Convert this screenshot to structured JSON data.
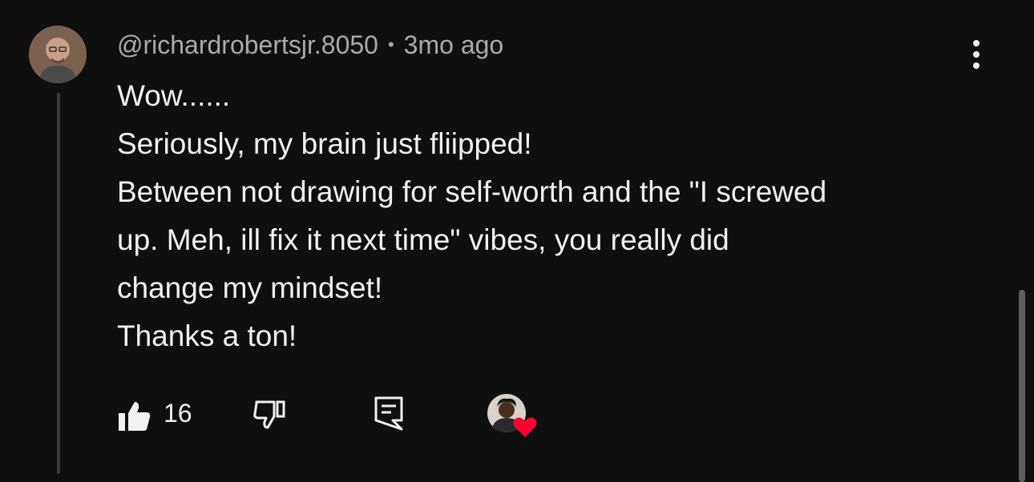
{
  "comment": {
    "author": "@richardrobertsjr.8050",
    "separator": "•",
    "timestamp": "3mo ago",
    "lines": [
      "Wow......",
      "Seriously, my brain just fliipped!",
      "Between not drawing for self-worth and the \"I screwed",
      "up. Meh, ill fix it next time\" vibes, you really did",
      "change my mindset!",
      "Thanks a ton!"
    ],
    "like_count": "16"
  },
  "icons": {
    "more": "more-vert-icon",
    "like": "thumbs-up-icon",
    "dislike": "thumbs-down-icon",
    "reply": "reply-comment-icon",
    "creator_heart": "creator-heart-icon"
  },
  "colors": {
    "background": "#0f0f0f",
    "text_primary": "#f1f1f1",
    "text_secondary": "#aaaaaa",
    "heart": "#ff0033"
  }
}
